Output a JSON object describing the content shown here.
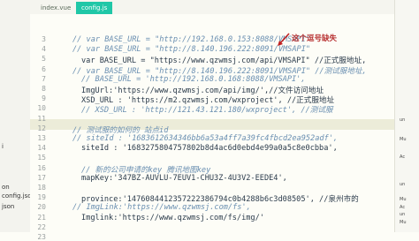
{
  "tabs": [
    "index.vue",
    "config.js"
  ],
  "annotation": "这个逗号缺失",
  "sidebar": {
    "items": [
      "i",
      "on",
      "config.json",
      "json"
    ]
  },
  "lines": [
    {
      "n": "3",
      "text": "// var BASE_URL = \"http://192.168.0.153:8088/VMSAPI\"",
      "kind": "cmt"
    },
    {
      "n": "4",
      "text": "// var BASE_URL = \"http://8.140.196.222:8091/VMSAPI\"",
      "kind": "cmt"
    },
    {
      "n": "5",
      "text": "var BASE_URL = \"https://www.qzwmsj.com/api/VMSAPI\" //正式服地址,",
      "kind": "norm"
    },
    {
      "n": "6",
      "text": "// var BASE_URL = \"http://8.140.196.222:8091/VMSAPI\" //测试服地址,",
      "kind": "cmt"
    },
    {
      "n": "7",
      "text": "// BASE_URL = 'http://192.168.0.168:8088/VMSAPI',",
      "kind": "cmt"
    },
    {
      "n": "8",
      "text": "ImgUrl:'https://www.qzwmsj.com/api/img/',//文件访问地址",
      "kind": "norm"
    },
    {
      "n": "9",
      "text": "XSD_URL : 'https://m2.qzwmsj.com/wxproject', //正式服地址",
      "kind": "norm"
    },
    {
      "n": "10",
      "text": "// XSD_URL : 'http://121.43.121.180/wxproject', //测试服",
      "kind": "cmt"
    },
    {
      "n": "11",
      "text": "",
      "kind": "norm"
    },
    {
      "n": "12",
      "text": "// 测试服的如何的 站点id",
      "kind": "cmt"
    },
    {
      "n": "13",
      "text": "// siteId : '1683612634346bb6a53a4ff7a39fc4fbcd2ea952adf',",
      "kind": "cmt"
    },
    {
      "n": "14",
      "text": "siteId : '1683275804757802b8d4ac6d0ebd4e99a0a5c8e0cbba',",
      "kind": "norm"
    },
    {
      "n": "15",
      "text": "",
      "kind": "norm"
    },
    {
      "n": "16",
      "text": "// 新的公司申请的key  腾讯地图key",
      "kind": "cmt"
    },
    {
      "n": "17",
      "text": "mapKey:'347BZ-AUVLU-7EUV1-CHU3Z-4U3V2-EEDE4',",
      "kind": "norm"
    },
    {
      "n": "18",
      "text": "",
      "kind": "norm"
    },
    {
      "n": "19",
      "text": "province:'1476084412357222386794c0b4288b6c3d08505', //泉州市的",
      "kind": "norm"
    },
    {
      "n": "20",
      "text": "// ImgLink:'https://www.qzwmsj.com/fs',",
      "kind": "cmt"
    },
    {
      "n": "21",
      "text": "Imglink:'https://www.qzwmsj.com/fs/img/'",
      "kind": "norm"
    },
    {
      "n": "22",
      "text": "",
      "kind": "norm"
    },
    {
      "n": "23",
      "text": "",
      "kind": "norm"
    }
  ],
  "right_badges": [
    "un",
    "Mu",
    "Ac",
    "un",
    "Mu",
    "Ac",
    "un",
    "Mu"
  ]
}
